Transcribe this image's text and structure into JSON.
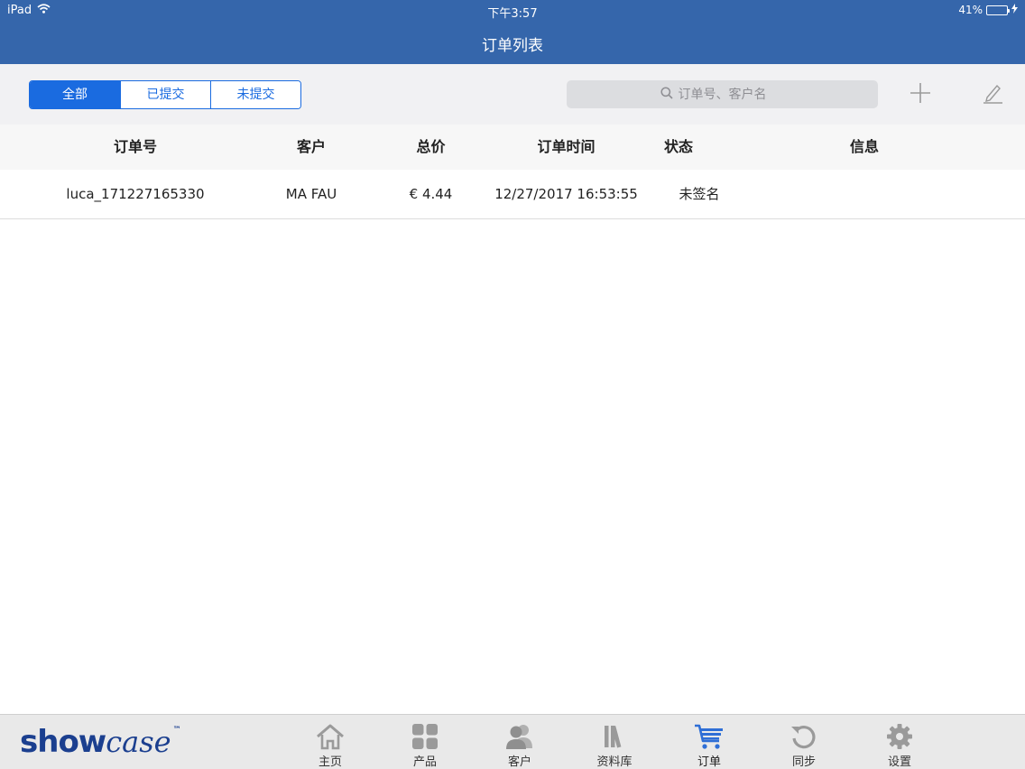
{
  "status_bar": {
    "device": "iPad",
    "time": "下午3:57",
    "battery": "41%",
    "battery_level": 0.41
  },
  "nav": {
    "title": "订单列表"
  },
  "filter": {
    "segments": [
      {
        "label": "全部",
        "active": true
      },
      {
        "label": "已提交",
        "active": false
      },
      {
        "label": "未提交",
        "active": false
      }
    ]
  },
  "search": {
    "placeholder": "订单号、客户名",
    "value": "",
    "icon": "search-icon"
  },
  "toolbar": {
    "add_icon": "plus-icon",
    "edit_icon": "pencil-icon"
  },
  "table": {
    "columns": [
      "订单号",
      "客户",
      "总价",
      "订单时间",
      "状态",
      "信息"
    ],
    "rows": [
      {
        "order_no": "luca_171227165330",
        "customer": "MA FAU",
        "total": "€ 4.44",
        "time": "12/27/2017 16:53:55",
        "status": "未签名",
        "info": ""
      }
    ]
  },
  "tabbar": {
    "logo": {
      "main": "show",
      "script": "case",
      "tm": "™"
    },
    "tabs": [
      {
        "label": "主页",
        "icon": "home-icon",
        "active": false
      },
      {
        "label": "产品",
        "icon": "grid-icon",
        "active": false
      },
      {
        "label": "客户",
        "icon": "users-icon",
        "active": false
      },
      {
        "label": "资料库",
        "icon": "library-icon",
        "active": false
      },
      {
        "label": "订单",
        "icon": "cart-icon",
        "active": true
      },
      {
        "label": "同步",
        "icon": "sync-icon",
        "active": false
      },
      {
        "label": "设置",
        "icon": "gear-icon",
        "active": false
      }
    ]
  },
  "colors": {
    "nav_blue": "#3566ab",
    "accent": "#1a6be0",
    "brand": "#1b3f8f",
    "tab_icon_inactive": "#9a9a9a"
  }
}
